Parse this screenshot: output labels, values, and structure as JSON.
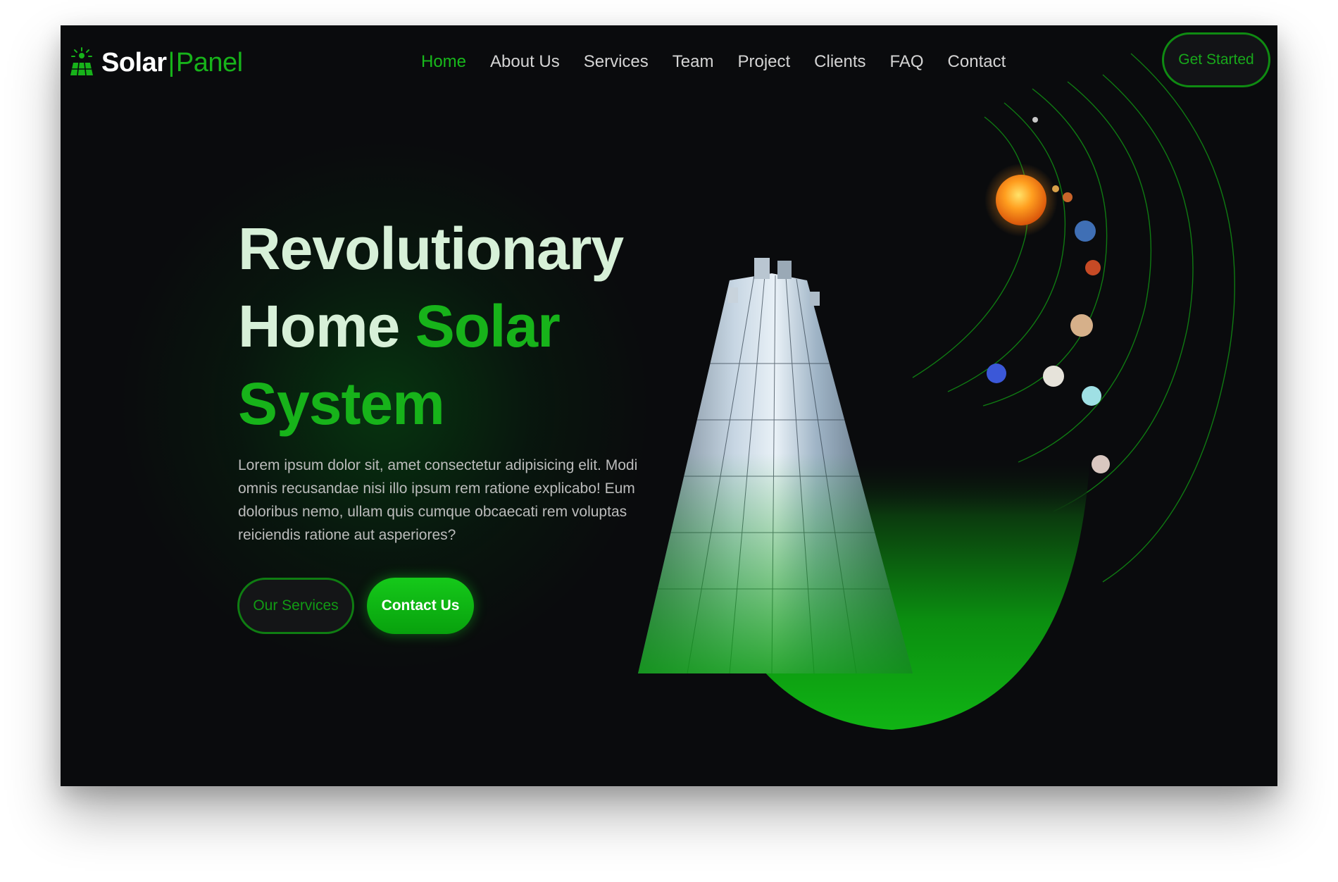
{
  "logo": {
    "solar": "Solar",
    "separator": "|",
    "panel": "Panel",
    "icon": "solar-panel-logo-icon"
  },
  "nav": {
    "items": [
      {
        "label": "Home",
        "active": true
      },
      {
        "label": "About Us"
      },
      {
        "label": "Services"
      },
      {
        "label": "Team"
      },
      {
        "label": "Project"
      },
      {
        "label": "Clients"
      },
      {
        "label": "FAQ"
      },
      {
        "label": "Contact"
      }
    ]
  },
  "header": {
    "cta_label": "Get Started"
  },
  "hero": {
    "title_line1": "Revolutionary",
    "title_line2_white": "Home",
    "title_line2_green": "Solar",
    "title_line3_green": "System",
    "description": "Lorem ipsum dolor sit, amet consectetur adipisicing elit. Modi omnis recusandae nisi illo ipsum rem ratione explicabo! Eum doloribus nemo, ullam quis cumque obcaecati rem voluptas reiciendis ratione aut asperiores?",
    "primary_button": "Our Services",
    "secondary_button": "Contact Us"
  },
  "colors": {
    "accent": "#17b31a",
    "background": "#0a0b0d",
    "title": "#d7f0d8",
    "text": "#bcbcbc"
  }
}
